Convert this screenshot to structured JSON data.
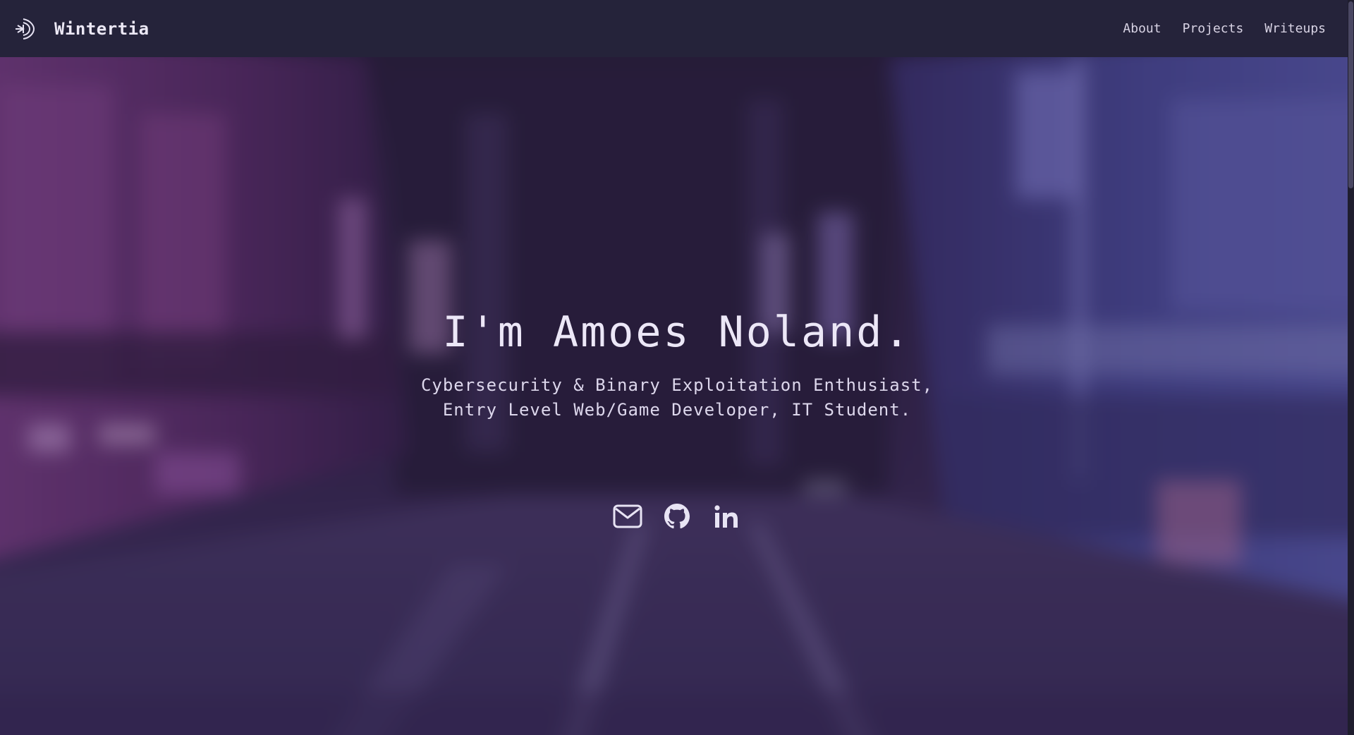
{
  "nav": {
    "brand": "Wintertia",
    "links": [
      {
        "label": "About"
      },
      {
        "label": "Projects"
      },
      {
        "label": "Writeups"
      }
    ]
  },
  "hero": {
    "title": "I'm Amoes Noland.",
    "subtitle_lines": [
      "Cybersecurity & Binary Exploitation Enthusiast,",
      "Entry Level Web/Game Developer, IT Student."
    ],
    "socials": [
      {
        "icon": "mail-icon"
      },
      {
        "icon": "github-icon"
      },
      {
        "icon": "linkedin-icon"
      }
    ]
  },
  "colors": {
    "navbar_bg": "#25233a",
    "text_light": "#ece7f7",
    "hero_tint": "#3a2a5c"
  }
}
